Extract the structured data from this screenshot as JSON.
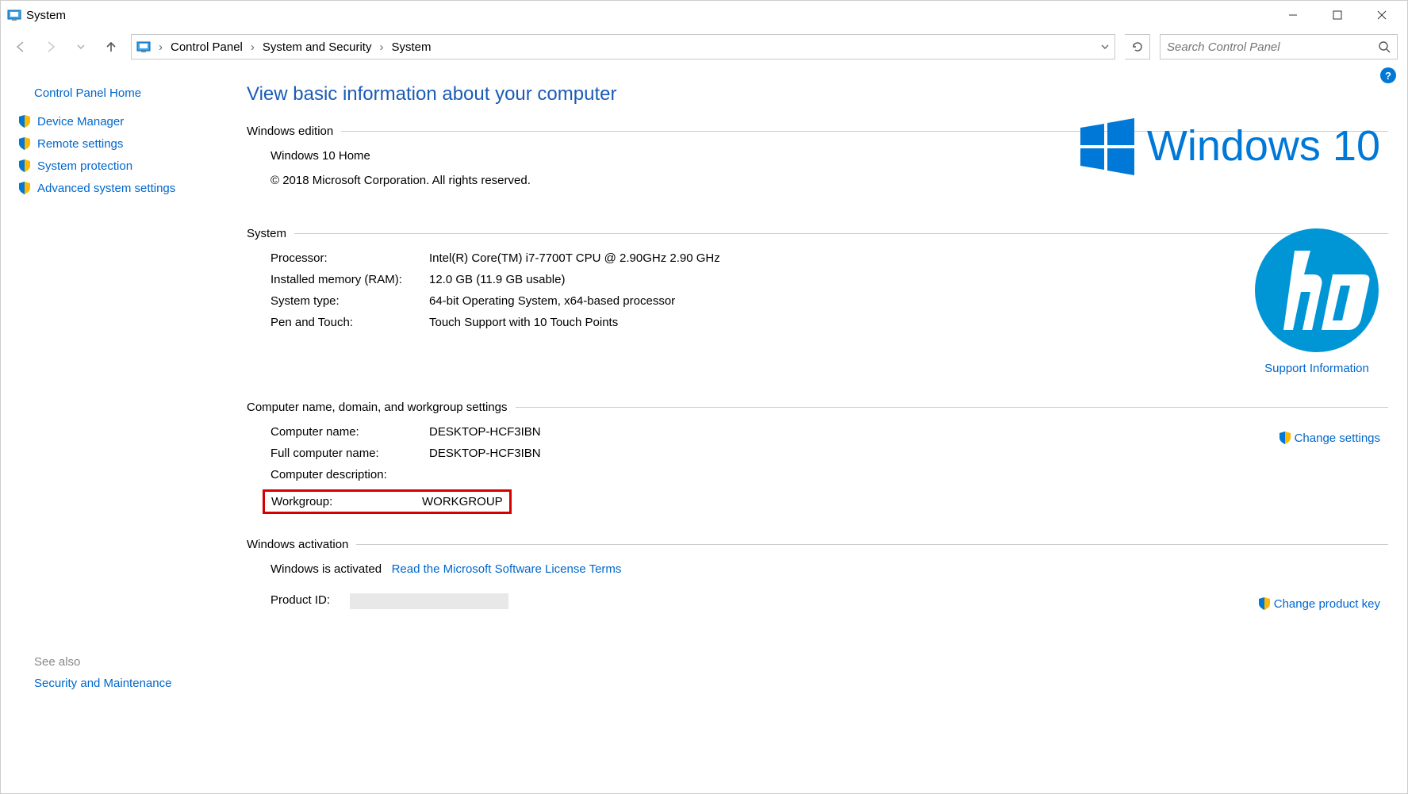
{
  "window": {
    "title": "System"
  },
  "breadcrumb": {
    "item0": "Control Panel",
    "item1": "System and Security",
    "item2": "System"
  },
  "search": {
    "placeholder": "Search Control Panel"
  },
  "sidebar": {
    "home": "Control Panel Home",
    "links": [
      "Device Manager",
      "Remote settings",
      "System protection",
      "Advanced system settings"
    ],
    "also_head": "See also",
    "also": [
      "Security and Maintenance"
    ]
  },
  "main": {
    "title": "View basic information about your computer",
    "win_logo_text": "Windows 10",
    "hp_support": "Support Information",
    "edition": {
      "head": "Windows edition",
      "name": "Windows 10 Home",
      "copyright": "© 2018 Microsoft Corporation. All rights reserved."
    },
    "system": {
      "head": "System",
      "processor_l": "Processor:",
      "processor_v": "Intel(R) Core(TM) i7-7700T CPU @ 2.90GHz   2.90 GHz",
      "ram_l": "Installed memory (RAM):",
      "ram_v": "12.0 GB (11.9 GB usable)",
      "type_l": "System type:",
      "type_v": "64-bit Operating System, x64-based processor",
      "pen_l": "Pen and Touch:",
      "pen_v": "Touch Support with 10 Touch Points"
    },
    "name": {
      "head": "Computer name, domain, and workgroup settings",
      "change": "Change settings",
      "cname_l": "Computer name:",
      "cname_v": "DESKTOP-HCF3IBN",
      "fname_l": "Full computer name:",
      "fname_v": "DESKTOP-HCF3IBN",
      "desc_l": "Computer description:",
      "desc_v": "",
      "work_l": "Workgroup:",
      "work_v": "WORKGROUP"
    },
    "activation": {
      "head": "Windows activation",
      "status": "Windows is activated",
      "license": "Read the Microsoft Software License Terms",
      "pid_l": "Product ID:",
      "change_key": "Change product key"
    }
  }
}
